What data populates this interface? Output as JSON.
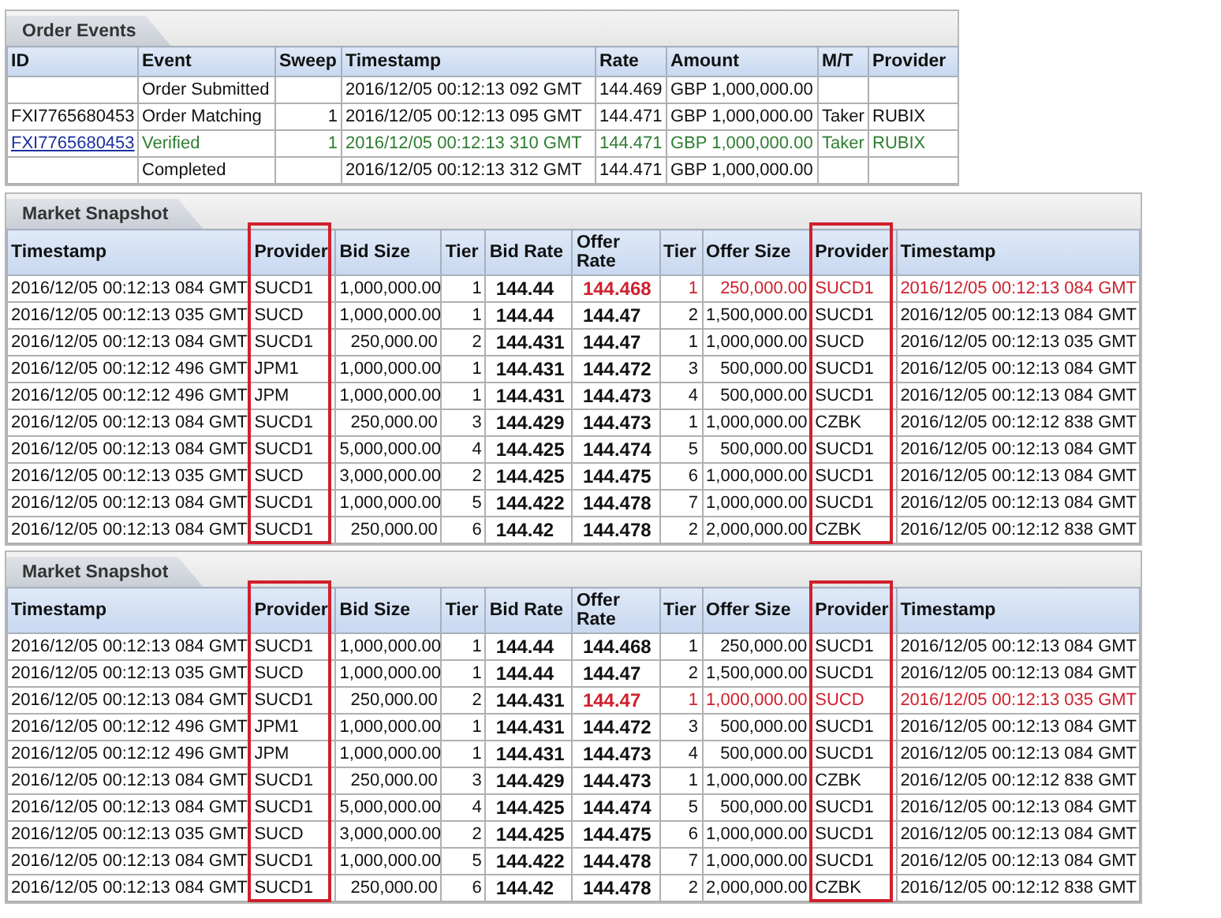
{
  "order_events": {
    "title": "Order Events",
    "columns": [
      "ID",
      "Event",
      "Sweep",
      "Timestamp",
      "Rate",
      "Amount",
      "M/T",
      "Provider"
    ],
    "rows": [
      {
        "kind": "plain",
        "cells": [
          null,
          "Order Submitted",
          null,
          "2016/12/05 00:12:13 092 GMT",
          "144.469",
          "GBP 1,000,000.00",
          null,
          null
        ]
      },
      {
        "kind": "plain",
        "cells": [
          "FXI7765680453",
          "Order Matching",
          "1",
          "2016/12/05 00:12:13 095 GMT",
          "144.471",
          "GBP 1,000,000.00",
          "Taker",
          "RUBIX"
        ]
      },
      {
        "kind": "verified",
        "cells": [
          "FXI7765680453",
          "Verified",
          "1",
          "2016/12/05 00:12:13 310 GMT",
          "144.471",
          "GBP 1,000,000.00",
          "Taker",
          "RUBIX"
        ]
      },
      {
        "kind": "plain",
        "cells": [
          null,
          "Completed",
          null,
          "2016/12/05 00:12:13 312 GMT",
          "144.471",
          "GBP 1,000,000.00",
          null,
          null
        ]
      }
    ]
  },
  "snapshots": [
    {
      "title": "Market Snapshot",
      "columns": [
        {
          "label": "Timestamp",
          "highlighted": false
        },
        {
          "label": "Provider",
          "highlighted": true
        },
        {
          "label": "Bid Size",
          "highlighted": false
        },
        {
          "label": "Tier",
          "highlighted": false
        },
        {
          "label": "Bid Rate",
          "highlighted": false
        },
        {
          "label": "Offer Rate",
          "highlighted": false
        },
        {
          "label": "Tier",
          "highlighted": false
        },
        {
          "label": "Offer Size",
          "highlighted": false
        },
        {
          "label": "Provider",
          "highlighted": true
        },
        {
          "label": "Timestamp",
          "highlighted": false
        }
      ],
      "rows": [
        {
          "offer_selected": true,
          "cells": [
            "2016/12/05 00:12:13 084 GMT",
            "SUCD1",
            "1,000,000.00",
            "1",
            "144.44",
            "144.468",
            "1",
            "250,000.00",
            "SUCD1",
            "2016/12/05 00:12:13 084 GMT"
          ]
        },
        {
          "offer_selected": false,
          "cells": [
            "2016/12/05 00:12:13 035 GMT",
            "SUCD",
            "1,000,000.00",
            "1",
            "144.44",
            "144.47",
            "2",
            "1,500,000.00",
            "SUCD1",
            "2016/12/05 00:12:13 084 GMT"
          ]
        },
        {
          "offer_selected": false,
          "cells": [
            "2016/12/05 00:12:13 084 GMT",
            "SUCD1",
            "250,000.00",
            "2",
            "144.431",
            "144.47",
            "1",
            "1,000,000.00",
            "SUCD",
            "2016/12/05 00:12:13 035 GMT"
          ]
        },
        {
          "offer_selected": false,
          "cells": [
            "2016/12/05 00:12:12 496 GMT",
            "JPM1",
            "1,000,000.00",
            "1",
            "144.431",
            "144.472",
            "3",
            "500,000.00",
            "SUCD1",
            "2016/12/05 00:12:13 084 GMT"
          ]
        },
        {
          "offer_selected": false,
          "cells": [
            "2016/12/05 00:12:12 496 GMT",
            "JPM",
            "1,000,000.00",
            "1",
            "144.431",
            "144.473",
            "4",
            "500,000.00",
            "SUCD1",
            "2016/12/05 00:12:13 084 GMT"
          ]
        },
        {
          "offer_selected": false,
          "cells": [
            "2016/12/05 00:12:13 084 GMT",
            "SUCD1",
            "250,000.00",
            "3",
            "144.429",
            "144.473",
            "1",
            "1,000,000.00",
            "CZBK",
            "2016/12/05 00:12:12 838 GMT"
          ]
        },
        {
          "offer_selected": false,
          "cells": [
            "2016/12/05 00:12:13 084 GMT",
            "SUCD1",
            "5,000,000.00",
            "4",
            "144.425",
            "144.474",
            "5",
            "500,000.00",
            "SUCD1",
            "2016/12/05 00:12:13 084 GMT"
          ]
        },
        {
          "offer_selected": false,
          "cells": [
            "2016/12/05 00:12:13 035 GMT",
            "SUCD",
            "3,000,000.00",
            "2",
            "144.425",
            "144.475",
            "6",
            "1,000,000.00",
            "SUCD1",
            "2016/12/05 00:12:13 084 GMT"
          ]
        },
        {
          "offer_selected": false,
          "cells": [
            "2016/12/05 00:12:13 084 GMT",
            "SUCD1",
            "1,000,000.00",
            "5",
            "144.422",
            "144.478",
            "7",
            "1,000,000.00",
            "SUCD1",
            "2016/12/05 00:12:13 084 GMT"
          ]
        },
        {
          "offer_selected": false,
          "cells": [
            "2016/12/05 00:12:13 084 GMT",
            "SUCD1",
            "250,000.00",
            "6",
            "144.42",
            "144.478",
            "2",
            "2,000,000.00",
            "CZBK",
            "2016/12/05 00:12:12 838 GMT"
          ]
        }
      ]
    },
    {
      "title": "Market Snapshot",
      "columns": [
        {
          "label": "Timestamp",
          "highlighted": false
        },
        {
          "label": "Provider",
          "highlighted": true
        },
        {
          "label": "Bid Size",
          "highlighted": false
        },
        {
          "label": "Tier",
          "highlighted": false
        },
        {
          "label": "Bid Rate",
          "highlighted": false
        },
        {
          "label": "Offer Rate",
          "highlighted": false
        },
        {
          "label": "Tier",
          "highlighted": false
        },
        {
          "label": "Offer Size",
          "highlighted": false
        },
        {
          "label": "Provider",
          "highlighted": true
        },
        {
          "label": "Timestamp",
          "highlighted": false
        }
      ],
      "rows": [
        {
          "offer_selected": false,
          "cells": [
            "2016/12/05 00:12:13 084 GMT",
            "SUCD1",
            "1,000,000.00",
            "1",
            "144.44",
            "144.468",
            "1",
            "250,000.00",
            "SUCD1",
            "2016/12/05 00:12:13 084 GMT"
          ]
        },
        {
          "offer_selected": false,
          "cells": [
            "2016/12/05 00:12:13 035 GMT",
            "SUCD",
            "1,000,000.00",
            "1",
            "144.44",
            "144.47",
            "2",
            "1,500,000.00",
            "SUCD1",
            "2016/12/05 00:12:13 084 GMT"
          ]
        },
        {
          "offer_selected": true,
          "cells": [
            "2016/12/05 00:12:13 084 GMT",
            "SUCD1",
            "250,000.00",
            "2",
            "144.431",
            "144.47",
            "1",
            "1,000,000.00",
            "SUCD",
            "2016/12/05 00:12:13 035 GMT"
          ]
        },
        {
          "offer_selected": false,
          "cells": [
            "2016/12/05 00:12:12 496 GMT",
            "JPM1",
            "1,000,000.00",
            "1",
            "144.431",
            "144.472",
            "3",
            "500,000.00",
            "SUCD1",
            "2016/12/05 00:12:13 084 GMT"
          ]
        },
        {
          "offer_selected": false,
          "cells": [
            "2016/12/05 00:12:12 496 GMT",
            "JPM",
            "1,000,000.00",
            "1",
            "144.431",
            "144.473",
            "4",
            "500,000.00",
            "SUCD1",
            "2016/12/05 00:12:13 084 GMT"
          ]
        },
        {
          "offer_selected": false,
          "cells": [
            "2016/12/05 00:12:13 084 GMT",
            "SUCD1",
            "250,000.00",
            "3",
            "144.429",
            "144.473",
            "1",
            "1,000,000.00",
            "CZBK",
            "2016/12/05 00:12:12 838 GMT"
          ]
        },
        {
          "offer_selected": false,
          "cells": [
            "2016/12/05 00:12:13 084 GMT",
            "SUCD1",
            "5,000,000.00",
            "4",
            "144.425",
            "144.474",
            "5",
            "500,000.00",
            "SUCD1",
            "2016/12/05 00:12:13 084 GMT"
          ]
        },
        {
          "offer_selected": false,
          "cells": [
            "2016/12/05 00:12:13 035 GMT",
            "SUCD",
            "3,000,000.00",
            "2",
            "144.425",
            "144.475",
            "6",
            "1,000,000.00",
            "SUCD1",
            "2016/12/05 00:12:13 084 GMT"
          ]
        },
        {
          "offer_selected": false,
          "cells": [
            "2016/12/05 00:12:13 084 GMT",
            "SUCD1",
            "1,000,000.00",
            "5",
            "144.422",
            "144.478",
            "7",
            "1,000,000.00",
            "SUCD1",
            "2016/12/05 00:12:13 084 GMT"
          ]
        },
        {
          "offer_selected": false,
          "cells": [
            "2016/12/05 00:12:13 084 GMT",
            "SUCD1",
            "250,000.00",
            "6",
            "144.42",
            "144.478",
            "2",
            "2,000,000.00",
            "CZBK",
            "2016/12/05 00:12:12 838 GMT"
          ]
        }
      ]
    }
  ]
}
